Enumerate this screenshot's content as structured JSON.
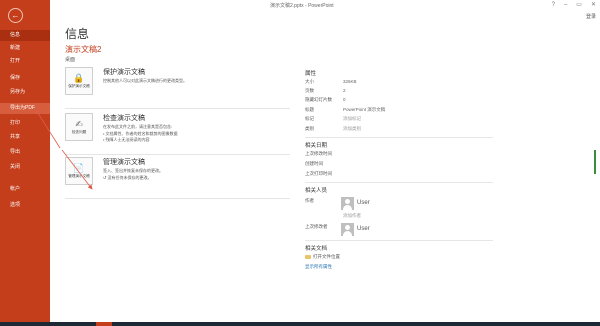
{
  "window": {
    "title": "演示文稿2.pptx - PowerPoint",
    "help_glyph": "?",
    "minimize_glyph": "–",
    "restore_glyph": "▭",
    "close_glyph": "✕",
    "signin": "登录"
  },
  "sidebar": {
    "back_glyph": "←",
    "items": [
      {
        "label": "信息",
        "state": "active"
      },
      {
        "label": "新建"
      },
      {
        "label": "打开"
      },
      {
        "label": "保存"
      },
      {
        "label": "另存为"
      },
      {
        "label": "导出为PDF",
        "state": "hover"
      },
      {
        "label": "打印"
      },
      {
        "label": "共享"
      },
      {
        "label": "导出"
      },
      {
        "label": "关闭"
      },
      {
        "label": "帐户"
      },
      {
        "label": "选项"
      }
    ],
    "colors": {
      "background": "#c43e1c",
      "active": "#a92f10",
      "hover": "#d65e3e"
    }
  },
  "main": {
    "page_title": "信息",
    "doc_title": "演示文稿2",
    "doc_location": "桌面",
    "actions": [
      {
        "button_label": "保护演示文稿",
        "icon": "lock-icon",
        "heading": "保护演示文稿",
        "description": "控制其他人可以对此演示文稿进行的更改类型。"
      },
      {
        "button_label": "检查问题",
        "icon": "inspect-icon",
        "heading": "检查演示文稿",
        "description": "在发布此文件之前，请注意其是否包含:",
        "bullets": [
          "文档属性、作者的姓名和裁剪的图像数据",
          "残障人士无法阅读的内容"
        ]
      },
      {
        "button_label": "管理演示文稿",
        "icon": "manage-icon",
        "heading": "管理演示文稿",
        "description": "签入、签出并恢复未保存的更改。",
        "sub_item": "没有任何未保存的更改。"
      }
    ]
  },
  "properties": {
    "header": "属性",
    "rows": [
      {
        "label": "大小",
        "value": "326KB"
      },
      {
        "label": "页数",
        "value": "2"
      },
      {
        "label": "隐藏幻灯片数",
        "value": "0"
      },
      {
        "label": "标题",
        "value": "PowerPoint 演示文稿"
      },
      {
        "label": "标记",
        "value": "添加标记",
        "muted": true
      },
      {
        "label": "类别",
        "value": "添加类别",
        "muted": true
      }
    ],
    "dates": {
      "header": "相关日期",
      "rows": [
        "上次修改时间",
        "创建时间",
        "上次打印时间"
      ]
    },
    "people": {
      "header": "相关人员",
      "author_label": "作者",
      "author_name": "User",
      "add_author": "添加作者",
      "modified_by_label": "上次修改者",
      "modified_by_name": "User"
    },
    "docs": {
      "header": "相关文档",
      "open_location": "打开文件位置",
      "show_all": "显示所有属性"
    }
  }
}
